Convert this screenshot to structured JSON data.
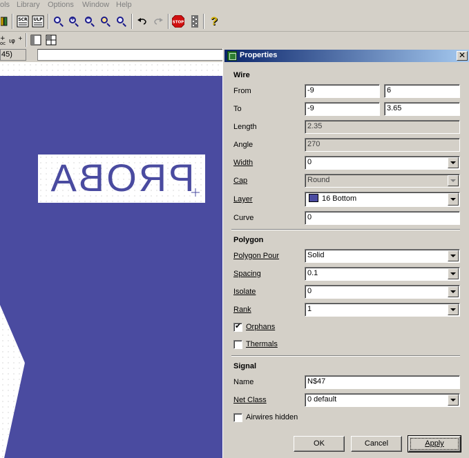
{
  "menubar": {
    "items": [
      "ols",
      "Library",
      "Options",
      "Window",
      "Help"
    ]
  },
  "toolbar": {
    "row1_icons": [
      "library-icon",
      "script-icon",
      "ulp-icon",
      "zoom-fit-icon",
      "zoom-in-icon",
      "zoom-out-icon",
      "zoom-redraw-icon",
      "zoom-select-icon",
      "undo-icon",
      "redo-icon",
      "stop-icon",
      "drc-icon",
      "help-icon"
    ],
    "stop_label": "STOP",
    "scr_label": "SCR",
    "ulp_label": "ULP",
    "help_label": "?"
  },
  "coordbar": {
    "readout": "45)"
  },
  "canvas": {
    "board_color": "#4a4ba0",
    "label_text": "PROBA"
  },
  "dialog": {
    "title": "Properties",
    "close_label": "✕",
    "wire": {
      "heading": "Wire",
      "from_label": "From",
      "from_x": "-9",
      "from_y": "6",
      "to_label": "To",
      "to_x": "-9",
      "to_y": "3.65",
      "length_label": "Length",
      "length": "2.35",
      "angle_label": "Angle",
      "angle": "270",
      "width_label": "Width",
      "width": "0",
      "cap_label": "Cap",
      "cap": "Round",
      "layer_label": "Layer",
      "layer": "16 Bottom",
      "layer_color": "#4a4ba0",
      "curve_label": "Curve",
      "curve": "0"
    },
    "polygon": {
      "heading": "Polygon",
      "pour_label": "Polygon Pour",
      "pour": "Solid",
      "spacing_label": "Spacing",
      "spacing": "0.1",
      "isolate_label": "Isolate",
      "isolate": "0",
      "rank_label": "Rank",
      "rank": "1",
      "orphans_label": "Orphans",
      "orphans_checked": true,
      "thermals_label": "Thermals",
      "thermals_checked": false
    },
    "signal": {
      "heading": "Signal",
      "name_label": "Name",
      "name": "N$47",
      "netclass_label": "Net Class",
      "netclass": "0 default",
      "airwires_label": "Airwires hidden",
      "airwires_checked": false
    },
    "buttons": {
      "ok": "OK",
      "cancel": "Cancel",
      "apply": "Apply"
    }
  }
}
